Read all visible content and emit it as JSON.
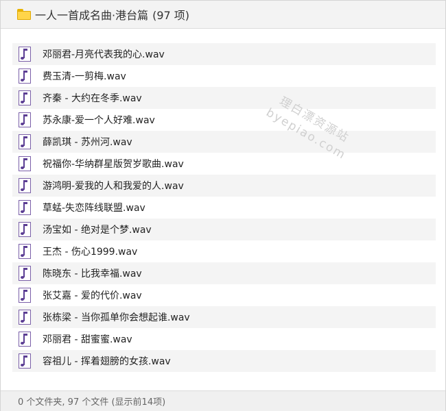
{
  "header": {
    "title": "一人一首成名曲·港台篇",
    "count": "(97 项)",
    "icon": "folder-icon"
  },
  "files": [
    {
      "name": "邓丽君-月亮代表我的心.wav"
    },
    {
      "name": "费玉清-一剪梅.wav"
    },
    {
      "name": "齐秦 - 大约在冬季.wav"
    },
    {
      "name": "苏永康-爱一个人好难.wav"
    },
    {
      "name": "薛凯琪 -  苏州河.wav"
    },
    {
      "name": "祝福你-华纳群星版贺岁歌曲.wav"
    },
    {
      "name": "游鸿明-爱我的人和我爱的人.wav"
    },
    {
      "name": "草蜢-失恋阵线联盟.wav"
    },
    {
      "name": "汤宝如 - 绝对是个梦.wav"
    },
    {
      "name": "王杰 - 伤心1999.wav"
    },
    {
      "name": "陈晓东 - 比我幸福.wav"
    },
    {
      "name": "张艾嘉 - 爱的代价.wav"
    },
    {
      "name": "张栋梁 - 当你孤单你会想起谁.wav"
    },
    {
      "name": "邓丽君 - 甜蜜蜜.wav"
    },
    {
      "name": "容祖儿 - 挥着翅膀的女孩.wav"
    }
  ],
  "file_icon": "audio-file-icon",
  "watermark": {
    "line1": "理白漂资源站",
    "line2": "byepiao.com"
  },
  "status": {
    "text": "0 个文件夹, 97 个文件 (显示前14项)"
  },
  "colors": {
    "row_alt": "#f4f4f4",
    "icon_purple": "#5b3d93",
    "folder_yellow": "#ffd54a"
  }
}
